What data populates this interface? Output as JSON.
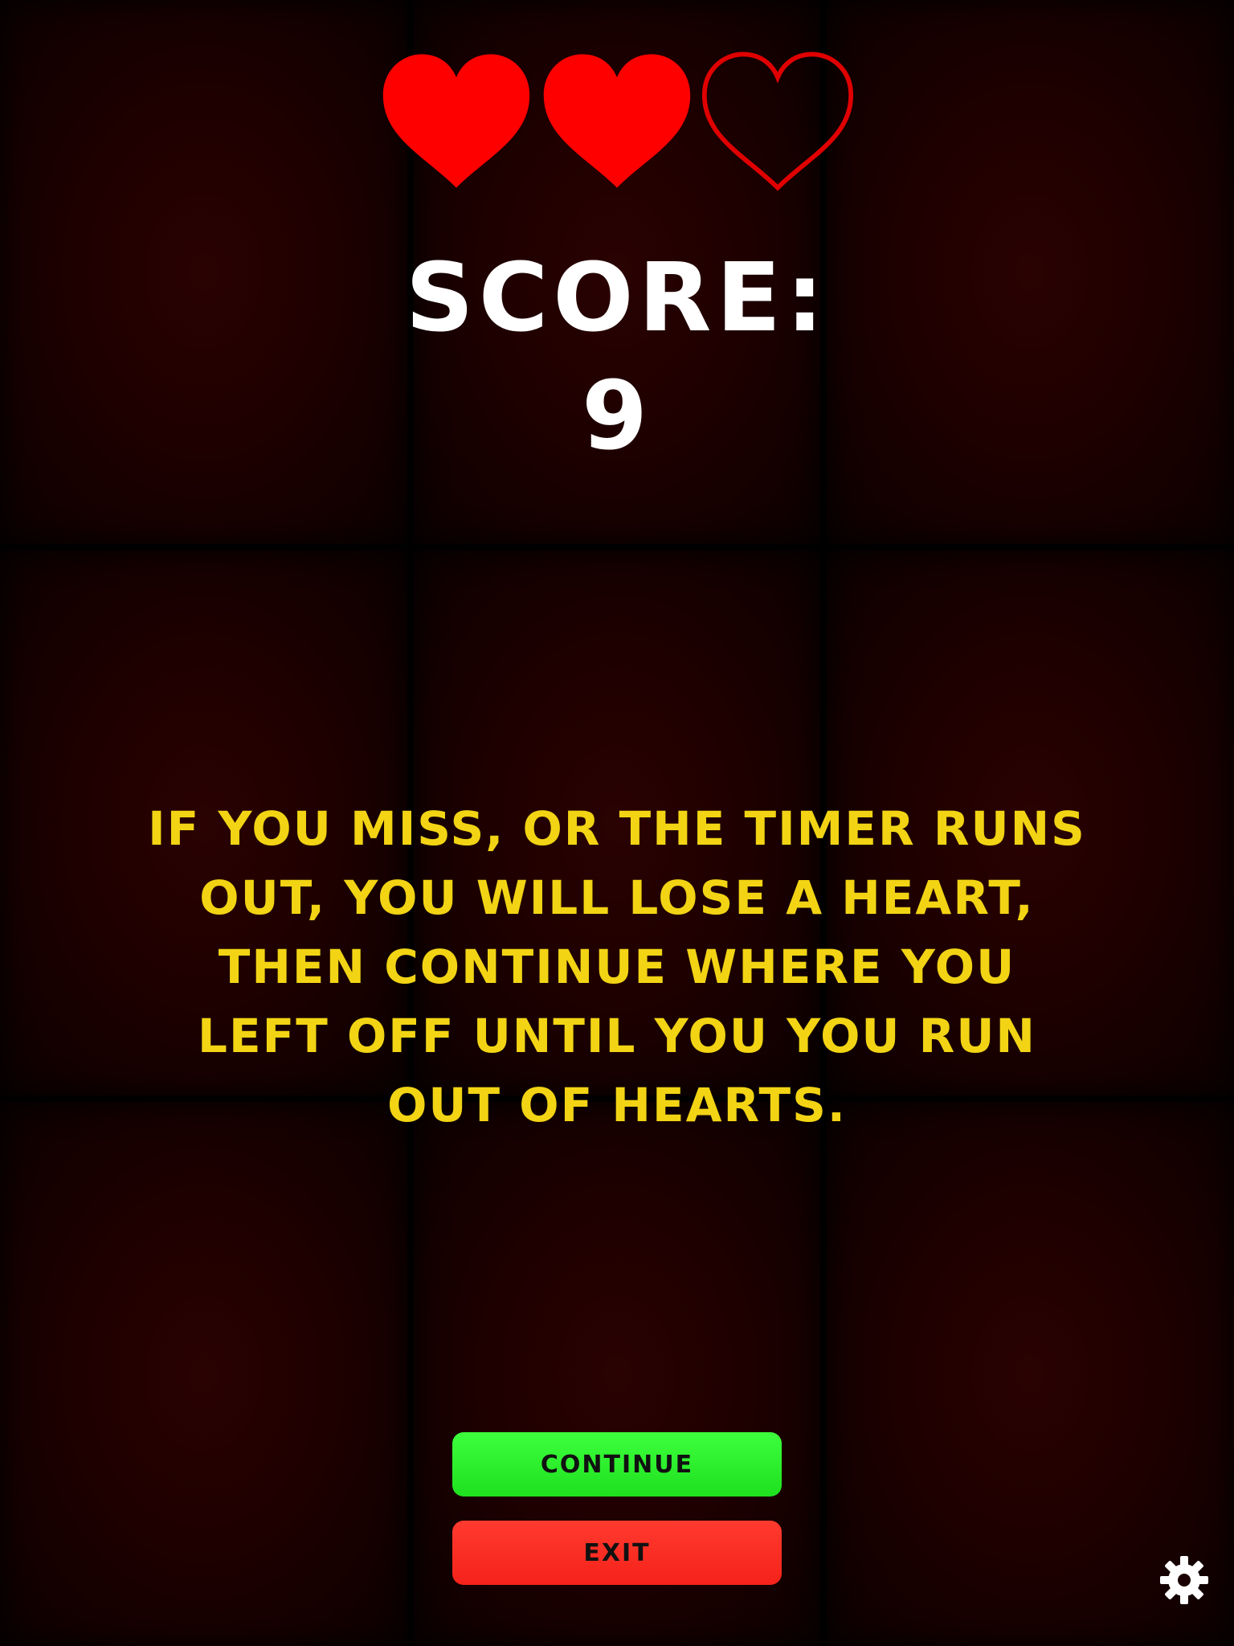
{
  "hearts": {
    "total": 3,
    "remaining": 2,
    "filled_color": "#ff0000",
    "empty_color": "#e00000"
  },
  "score": {
    "label": "SCORE:",
    "value": "9"
  },
  "message": "IF YOU MISS, OR THE TIMER RUNS\nOUT, YOU WILL LOSE A HEART,\nTHEN  CONTINUE WHERE YOU\nLEFT OFF  UNTIL YOU YOU RUN\nOUT OF HEARTS.",
  "buttons": {
    "continue_label": "CONTINUE",
    "exit_label": "EXIT"
  },
  "settings_icon": "gear-icon",
  "colors": {
    "message_text": "#f2d414",
    "continue_button": "#22ee22",
    "exit_button": "#f82a20"
  }
}
